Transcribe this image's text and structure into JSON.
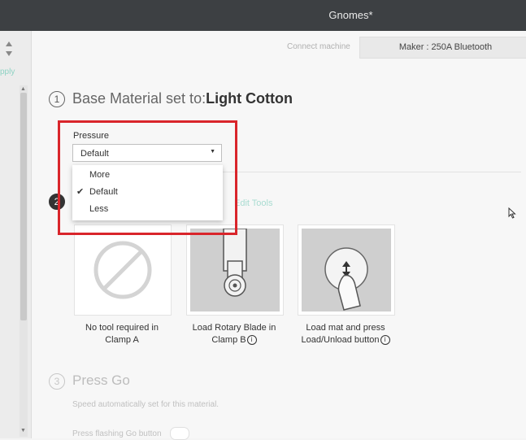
{
  "window": {
    "title": "Gnomes*"
  },
  "left_panel": {
    "apply_label": "pply"
  },
  "header": {
    "connect_label": "Connect machine",
    "machine_button": "Maker : 250A Bluetooth"
  },
  "step1": {
    "number": "1",
    "prefix": "Base Material set to:",
    "material": "Light Cotton"
  },
  "pressure": {
    "label": "Pressure",
    "selected": "Default",
    "options": [
      {
        "label": "More",
        "checked": false
      },
      {
        "label": "Default",
        "checked": true
      },
      {
        "label": "Less",
        "checked": false
      }
    ]
  },
  "step2": {
    "number": "2",
    "edit_tools": "Edit Tools",
    "tools": [
      {
        "line1": "No tool required in",
        "line2": "Clamp A",
        "icon": "no-tool-icon"
      },
      {
        "line1": "Load Rotary Blade in",
        "line2": "Clamp B",
        "icon": "rotary-blade-icon"
      },
      {
        "line1": "Load mat and press",
        "line2": "Load/Unload button",
        "icon": "load-unload-button-icon"
      }
    ]
  },
  "step3": {
    "number": "3",
    "title": "Press Go",
    "subtitle": "Speed automatically set for this material.",
    "instruction": "Press flashing Go button"
  }
}
